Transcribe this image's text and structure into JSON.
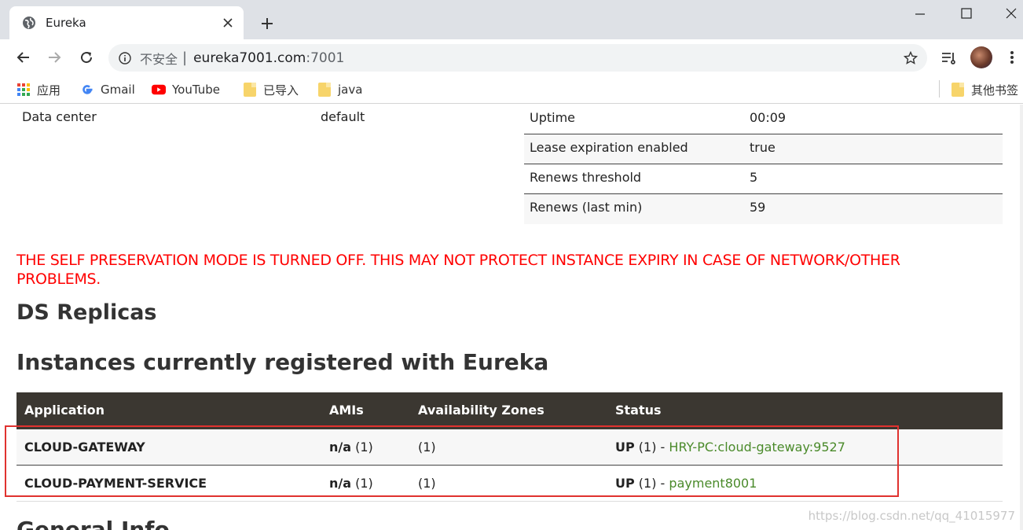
{
  "browser": {
    "tab_title": "Eureka",
    "omnibox_security": "不安全",
    "omnibox_separator": "|",
    "omnibox_host": "eureka7001.com",
    "omnibox_port": ":7001",
    "bookmarks": {
      "apps": "应用",
      "gmail": "Gmail",
      "youtube": "YouTube",
      "imported": "已导入",
      "java": "java",
      "other": "其他书签"
    }
  },
  "general": {
    "left_key": "Data center",
    "left_value": "default",
    "stats": [
      {
        "key": "Uptime",
        "value": "00:09"
      },
      {
        "key": "Lease expiration enabled",
        "value": "true"
      },
      {
        "key": "Renews threshold",
        "value": "5"
      },
      {
        "key": "Renews (last min)",
        "value": "59"
      }
    ]
  },
  "warning": "THE SELF PRESERVATION MODE IS TURNED OFF. THIS MAY NOT PROTECT INSTANCE EXPIRY IN CASE OF NETWORK/OTHER PROBLEMS.",
  "replicas_heading": "DS Replicas",
  "instances_heading": "Instances currently registered with Eureka",
  "instances": {
    "headers": {
      "application": "Application",
      "amis": "AMIs",
      "zones": "Availability Zones",
      "status": "Status"
    },
    "rows": [
      {
        "application": "CLOUD-GATEWAY",
        "ami_name": "n/a",
        "ami_count": " (1)",
        "zones": "(1)",
        "status_state": "UP",
        "status_count": " (1) - ",
        "instance": "HRY-PC:cloud-gateway:9527"
      },
      {
        "application": "CLOUD-PAYMENT-SERVICE",
        "ami_name": "n/a",
        "ami_count": " (1)",
        "zones": "(1)",
        "status_state": "UP",
        "status_count": " (1) - ",
        "instance": "payment8001"
      }
    ]
  },
  "footer_heading": "General Info",
  "watermark": "https://blog.csdn.net/qq_41015977",
  "colors": {
    "warning": "#ff0000",
    "table_header": "#3b3731",
    "link": "#4a8a2a",
    "highlight_box": "#e0322f"
  }
}
